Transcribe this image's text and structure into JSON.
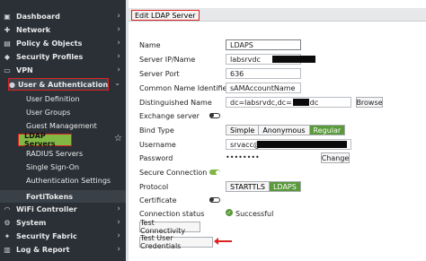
{
  "sidebar": {
    "items": [
      {
        "label": "Dashboard",
        "icon": "dashboard-icon"
      },
      {
        "label": "Network",
        "icon": "network-icon"
      },
      {
        "label": "Policy & Objects",
        "icon": "policy-icon"
      },
      {
        "label": "Security Profiles",
        "icon": "shield-icon"
      },
      {
        "label": "VPN",
        "icon": "vpn-icon"
      },
      {
        "label": "User & Authentication",
        "icon": "user-icon"
      }
    ],
    "sub_items": [
      {
        "label": "User Definition"
      },
      {
        "label": "User Groups"
      },
      {
        "label": "Guest Management"
      },
      {
        "label": "LDAP Servers"
      },
      {
        "label": "RADIUS Servers"
      },
      {
        "label": "Single Sign-On"
      },
      {
        "label": "Authentication Settings"
      },
      {
        "label": "FortiTokens"
      }
    ],
    "bottom_items": [
      {
        "label": "WiFi Controller",
        "icon": "wifi-icon"
      },
      {
        "label": "System",
        "icon": "gear-icon"
      },
      {
        "label": "Security Fabric",
        "icon": "fabric-icon"
      },
      {
        "label": "Log & Report",
        "icon": "chart-icon"
      }
    ]
  },
  "header": {
    "title": "Edit LDAP Server"
  },
  "form": {
    "name_label": "Name",
    "name_value": "LDAPS",
    "ip_label": "Server IP/Name",
    "ip_value": "labsrvdc",
    "port_label": "Server Port",
    "port_value": "636",
    "cn_label": "Common Name Identifier",
    "cn_value": "sAMAccountName",
    "dn_label": "Distinguished Name",
    "dn_value": "dc=labsrvdc,dc=",
    "dn_value2": "dc",
    "browse_label": "Browse",
    "exchange_label": "Exchange server",
    "bind_label": "Bind Type",
    "bind_options": [
      "Simple",
      "Anonymous",
      "Regular"
    ],
    "username_label": "Username",
    "username_value": "srvacc@",
    "password_label": "Password",
    "password_value": "••••••••",
    "change_label": "Change",
    "secure_label": "Secure Connection",
    "protocol_label": "Protocol",
    "protocol_options": [
      "STARTTLS",
      "LDAPS"
    ],
    "cert_label": "Certificate",
    "status_label": "Connection status",
    "status_value": "Successful",
    "test_conn_label": "Test Connectivity",
    "test_cred_label": "Test User Credentials"
  },
  "colors": {
    "accent": "#5a9a3b",
    "highlight": "#82b844",
    "annotation": "#dd2222",
    "sidebar_bg": "#2b3036"
  }
}
